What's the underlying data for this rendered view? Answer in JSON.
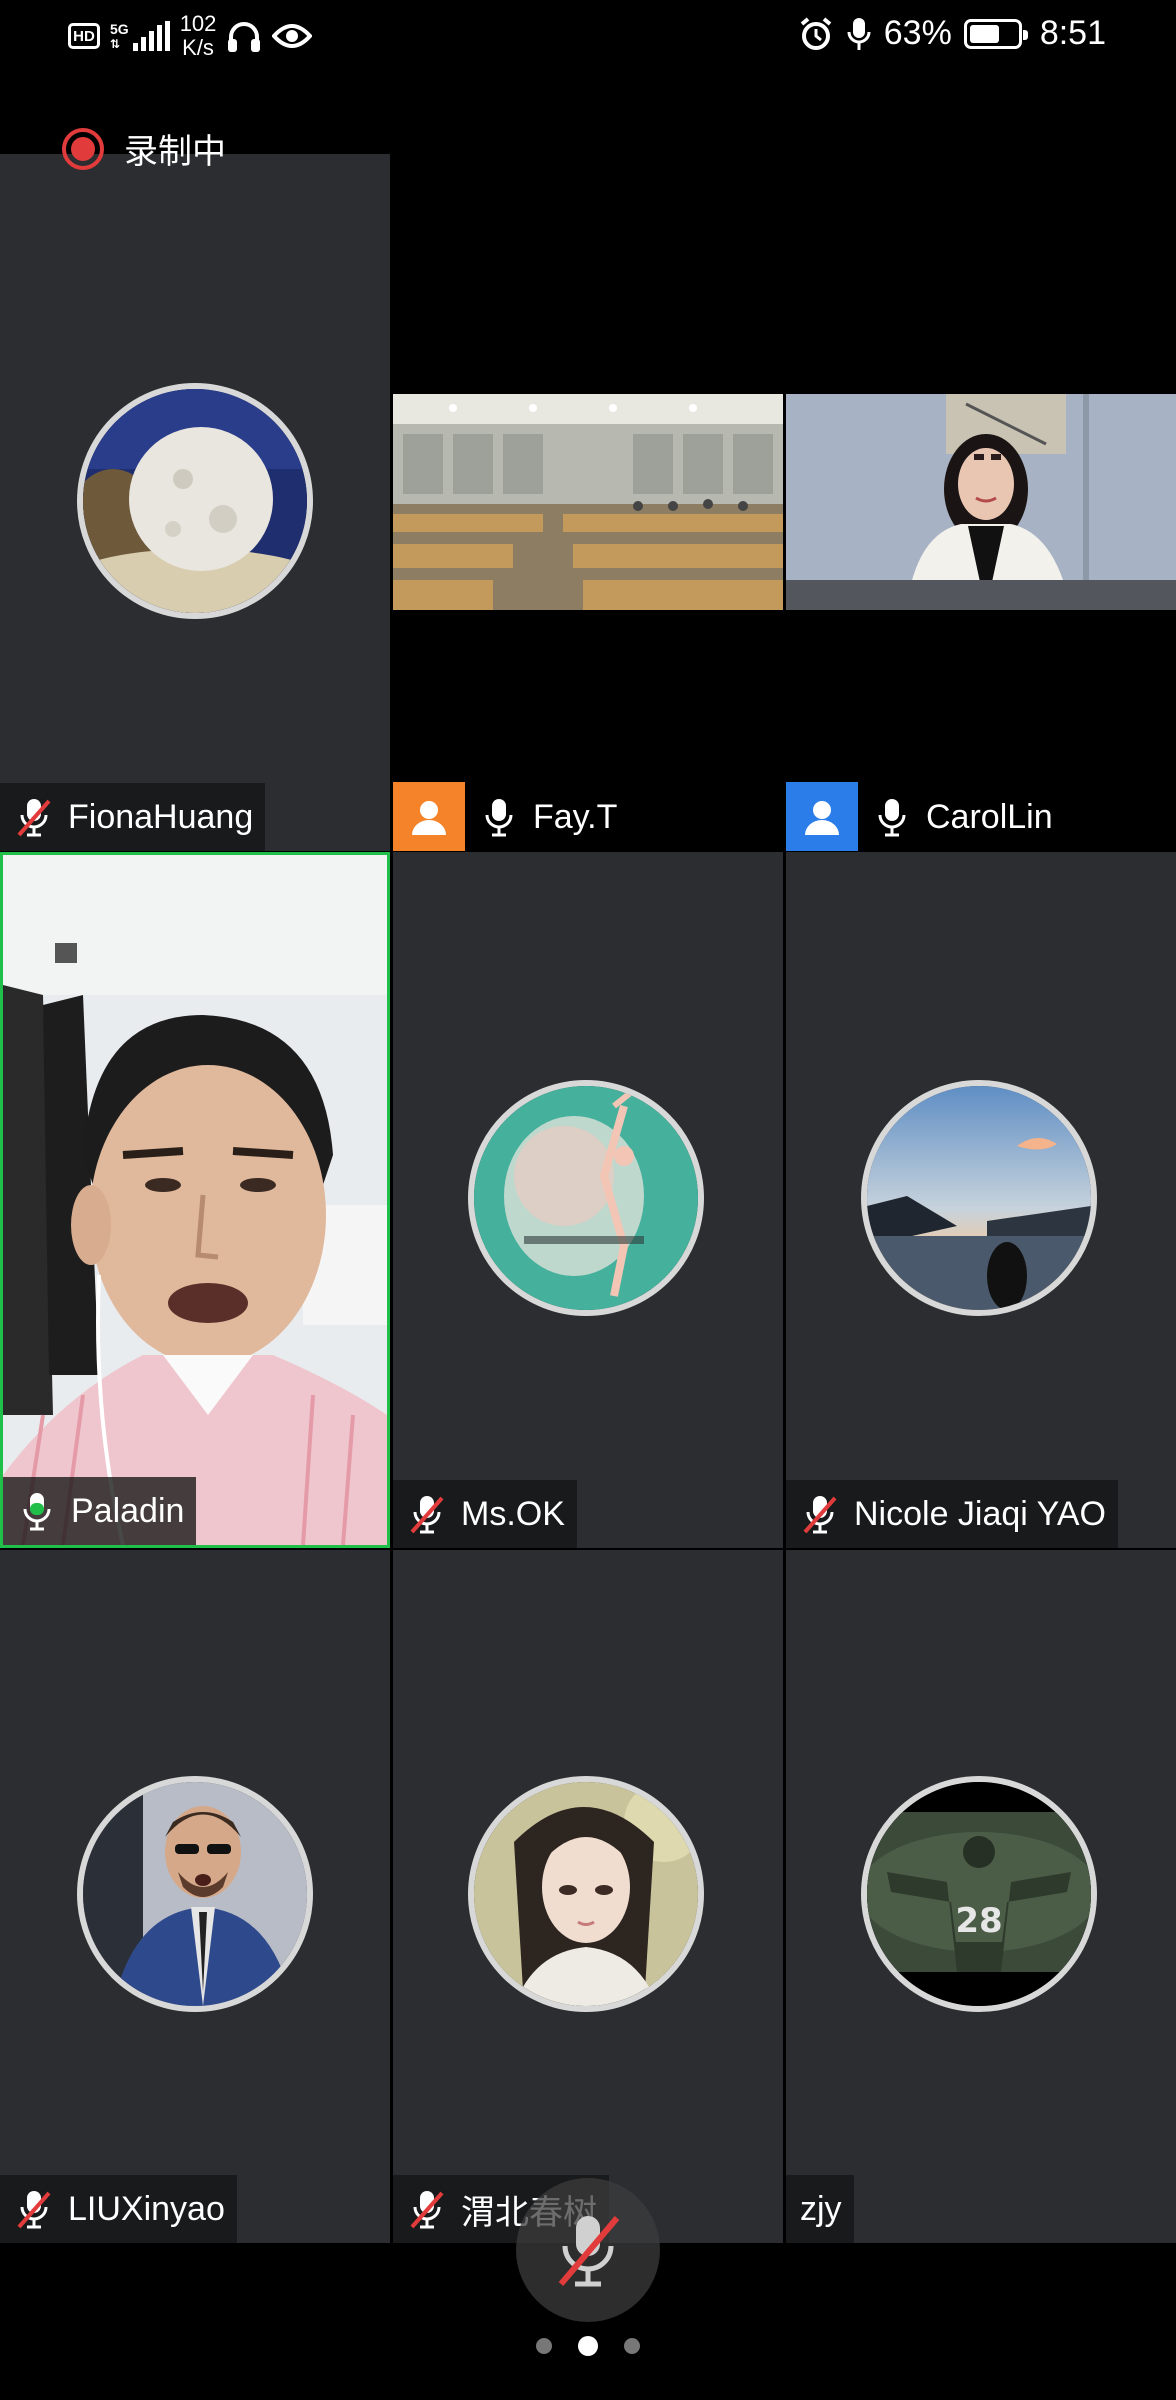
{
  "status_bar": {
    "hd": "HD",
    "network": "5G",
    "speed_value": "102",
    "speed_unit": "K/s",
    "battery": "63%",
    "battery_level": 0.63,
    "time": "8:51"
  },
  "recording": {
    "label": "录制中",
    "color": "#e23b3b"
  },
  "participants": [
    {
      "name": "FionaHuang",
      "mic": "muted",
      "view": "avatar",
      "avatar": "moon-lamp"
    },
    {
      "name": "Fay.T",
      "mic": "on",
      "view": "video",
      "badge_color": "#f4832a",
      "video": "empty-classroom"
    },
    {
      "name": "CarolLin",
      "mic": "on",
      "view": "video",
      "badge_color": "#2b7de9",
      "video": "woman-white-blazer"
    },
    {
      "name": "Paladin",
      "mic": "speaking",
      "view": "video",
      "video": "man-pink-shirt",
      "active_speaker": true
    },
    {
      "name": "Ms.OK",
      "mic": "muted",
      "view": "avatar",
      "avatar": "ballet-dancer-illustration"
    },
    {
      "name": "Nicole Jiaqi YAO",
      "mic": "muted",
      "view": "avatar",
      "avatar": "sunset-lake"
    },
    {
      "name": "LIUXinyao",
      "mic": "muted",
      "view": "avatar",
      "avatar": "man-in-suit-sunglasses"
    },
    {
      "name": "渭北春树",
      "mic": "muted",
      "view": "avatar",
      "avatar": "anime-portrait"
    },
    {
      "name": "zjy",
      "mic": "none",
      "view": "avatar",
      "avatar": "jersey-28-player"
    }
  ],
  "controls": {
    "mic_button": "muted-mic"
  },
  "pagination": {
    "pages": 3,
    "current": 2
  },
  "colors": {
    "active_speaker": "#1fbf4a",
    "tile_bg": "#2b2d30",
    "muted_slash": "#e23b3b"
  }
}
